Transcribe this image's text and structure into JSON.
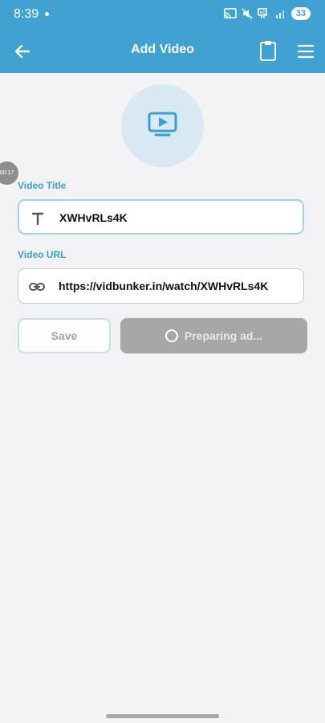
{
  "status_bar": {
    "time": "8:39",
    "battery": "33",
    "icons": [
      "cast-icon",
      "mute-icon",
      "hotspot-icon",
      "signal-icon",
      "battery-icon"
    ]
  },
  "app_bar": {
    "title": "Add Video",
    "icons": [
      "back-arrow-icon",
      "clipboard-icon",
      "menu-icon"
    ],
    "color": "#3fa2d2"
  },
  "hero": {
    "icon": "video-play-icon"
  },
  "timer_bubble": "00:17",
  "form": {
    "title_label": "Video Title",
    "title_value": "XWHvRLs4K",
    "title_icon": "text-t-icon",
    "url_label": "Video URL",
    "url_value": "https://vidbunker.in/watch/XWHvRLs4K",
    "url_icon": "link-icon"
  },
  "buttons": {
    "save_label": "Save",
    "ad_label": "Preparing ad..."
  }
}
